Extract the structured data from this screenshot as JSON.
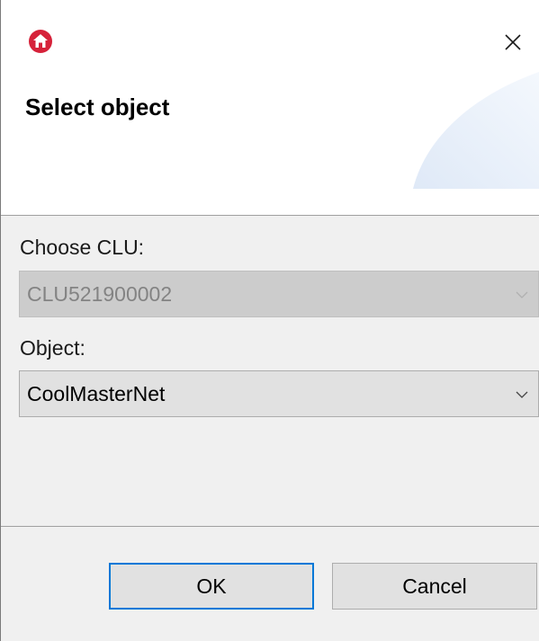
{
  "window": {
    "close_symbol": "✕",
    "accent_color": "#0078d7",
    "app_icon": "home-icon",
    "app_icon_color": "#d6223a"
  },
  "header": {
    "title": "Select object"
  },
  "form": {
    "clu_label": "Choose CLU:",
    "clu_value": "CLU521900002",
    "clu_disabled": true,
    "object_label": "Object:",
    "object_value": "CoolMasterNet"
  },
  "buttons": {
    "ok_label": "OK",
    "cancel_label": "Cancel"
  }
}
